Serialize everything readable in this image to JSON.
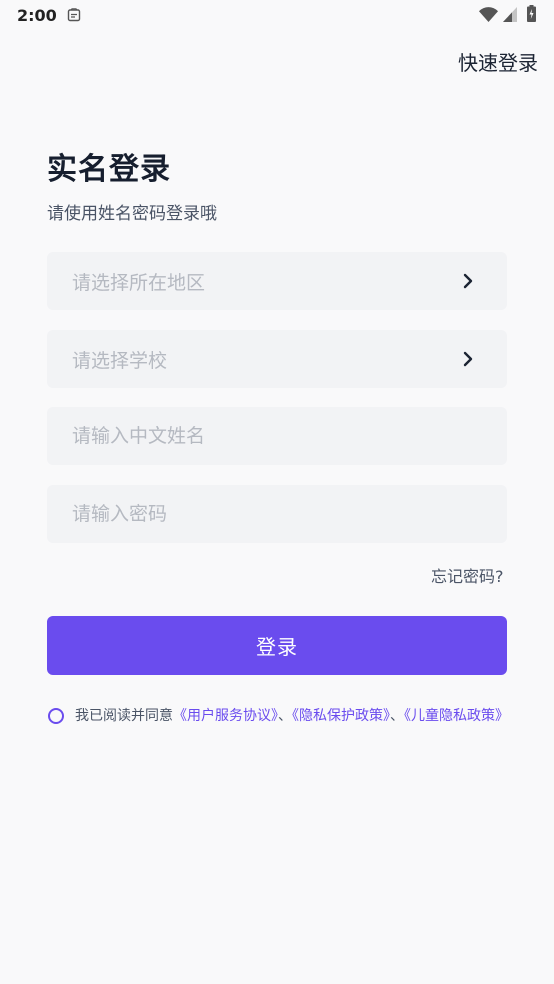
{
  "status_bar": {
    "time": "2:00",
    "notification_icon": "clipboard-icon",
    "wifi_icon": "wifi-icon",
    "signal_icon": "cell-signal-icon",
    "battery_icon": "battery-icon"
  },
  "header": {
    "quick_login_label": "快速登录"
  },
  "page": {
    "title": "实名登录",
    "subtitle": "请使用姓名密码登录哦"
  },
  "form": {
    "region_placeholder": "请选择所在地区",
    "school_placeholder": "请选择学校",
    "name_placeholder": "请输入中文姓名",
    "password_placeholder": "请输入密码",
    "chevron_icon": "chevron-right-icon",
    "forgot_password_label": "忘记密码?",
    "login_button_label": "登录"
  },
  "agreement": {
    "checked": false,
    "prefix": "我已阅读并同意",
    "user_agreement": "《用户服务协议》",
    "separator_1": "、",
    "privacy_policy": "《隐私保护政策》",
    "separator_2": "、",
    "child_privacy_policy": "《儿童隐私政策》"
  },
  "colors": {
    "accent": "#6a4cee",
    "background": "#f9f9fa",
    "field_background": "#f2f3f5",
    "placeholder": "#b5b9c1",
    "title": "#161e2e",
    "secondary_text": "#4a5466"
  }
}
